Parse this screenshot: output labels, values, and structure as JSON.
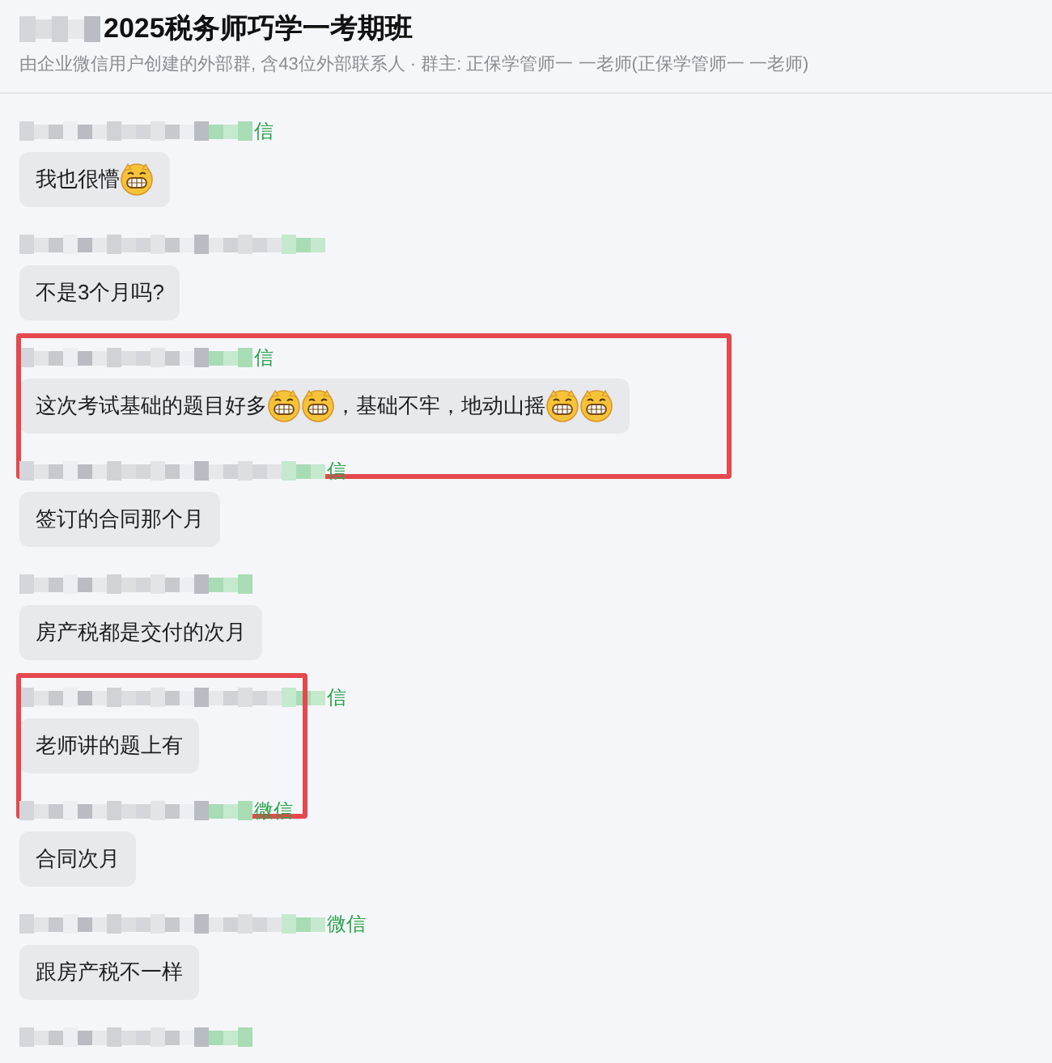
{
  "header": {
    "title": "2025税务师巧学一考期班",
    "subtitle": "由企业微信用户创建的外部群, 含43位外部联系人 · 群主: 正保学管师一 一老师(正保学管师一 一老师)"
  },
  "messages": [
    {
      "sender_suffix": "信",
      "highlighted": false,
      "parts": [
        {
          "kind": "text",
          "text": "我也很懵"
        },
        {
          "kind": "emoji"
        }
      ]
    },
    {
      "highlighted": false,
      "parts": [
        {
          "kind": "text",
          "text": "不是3个月吗?"
        }
      ]
    },
    {
      "sender_suffix": "信",
      "highlighted": true,
      "parts": [
        {
          "kind": "text",
          "text": "这次考试基础的题目好多"
        },
        {
          "kind": "emoji"
        },
        {
          "kind": "emoji"
        },
        {
          "kind": "text",
          "text": "，基础不牢，地动山摇"
        },
        {
          "kind": "emoji"
        },
        {
          "kind": "emoji"
        }
      ]
    },
    {
      "sender_suffix": "信",
      "highlighted": false,
      "parts": [
        {
          "kind": "text",
          "text": "签订的合同那个月"
        }
      ]
    },
    {
      "highlighted": false,
      "parts": [
        {
          "kind": "text",
          "text": "房产税都是交付的次月"
        }
      ]
    },
    {
      "sender_suffix": "信",
      "highlighted": true,
      "parts": [
        {
          "kind": "text",
          "text": "老师讲的题上有"
        }
      ]
    },
    {
      "sender_suffix": "微信",
      "highlighted": false,
      "parts": [
        {
          "kind": "text",
          "text": "合同次月"
        }
      ]
    },
    {
      "sender_suffix": "微信",
      "highlighted": false,
      "parts": [
        {
          "kind": "text",
          "text": "跟房产税不一样"
        }
      ]
    },
    {
      "highlighted": false
    }
  ]
}
